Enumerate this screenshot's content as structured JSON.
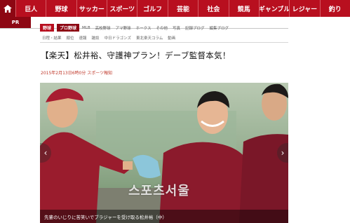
{
  "colors": {
    "brand_red": "#b80f1f",
    "dark_red": "#8d0713",
    "date_red": "#c0392b"
  },
  "topnav": {
    "home_icon": "home-icon",
    "items": [
      "巨人",
      "野球",
      "サッカー",
      "スポーツ",
      "ゴルフ",
      "芸能",
      "社会",
      "競馬",
      "ギャンブル",
      "レジャー",
      "釣り"
    ]
  },
  "strip": {
    "brand": "PR"
  },
  "subnav": {
    "active_tab": "野球",
    "tab2": "プロ野球",
    "items": [
      "MLB",
      "高校野球",
      "アマ野球",
      "ホークス",
      "その他",
      "写真",
      "記録ブログ",
      "編集ブログ"
    ]
  },
  "subnav2": {
    "items": [
      "日程・結果",
      "順位",
      "速報",
      "雑談",
      "中日ドラゴンズ",
      "東北楽天コラム",
      "動画"
    ]
  },
  "article": {
    "headline": "【楽天】松井裕、守護神プラン！デーブ監督本気！",
    "date": "2015年2月13日6時0分  スポーツ報知"
  },
  "photo": {
    "watermark": "스포츠서울",
    "caption": "先輩のいじりに苦笑いでブラジャーを受け取る松井裕（中）",
    "prev_icon": "chevron-left-icon",
    "next_icon": "chevron-right-icon",
    "prev_glyph": "‹",
    "next_glyph": "›"
  }
}
